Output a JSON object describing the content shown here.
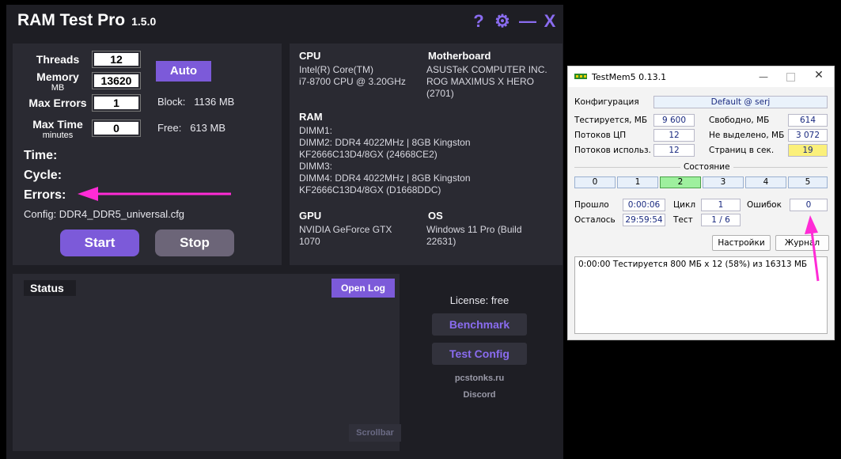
{
  "app": {
    "title": "RAM Test Pro",
    "version": "1.5.0"
  },
  "header": {
    "help_icon": "?",
    "gear_icon": "⚙",
    "minimize_icon": "—",
    "close_icon": "X"
  },
  "settings": {
    "threads_label": "Threads",
    "threads_value": "12",
    "memory_label": "Memory",
    "memory_unit": "MB",
    "memory_value": "13620",
    "max_errors_label": "Max Errors",
    "max_errors_value": "1",
    "max_time_label": "Max Time",
    "max_time_unit": "minutes",
    "max_time_value": "0",
    "auto_label": "Auto",
    "block_label": "Block:",
    "block_value": "1136 MB",
    "free_label": "Free:",
    "free_value": "613 MB"
  },
  "stats": {
    "time_label": "Time:",
    "cycle_label": "Cycle:",
    "errors_label": "Errors:"
  },
  "config": {
    "text": "Config: DDR4_DDR5_universal.cfg"
  },
  "controls": {
    "start_label": "Start",
    "stop_label": "Stop"
  },
  "system": {
    "cpu_label": "CPU",
    "cpu_lines": [
      "Intel(R) Core(TM)",
      "i7-8700 CPU @ 3.20GHz"
    ],
    "mb_label": "Motherboard",
    "mb_lines": [
      "ASUSTeK COMPUTER INC.",
      "ROG MAXIMUS X HERO",
      "(2701)"
    ],
    "ram_label": "RAM",
    "ram_lines": [
      "DIMM1:",
      "DIMM2: DDR4 4022MHz | 8GB Kingston",
      "KF2666C13D4/8GX (24668CE2)",
      "DIMM3:",
      "DIMM4: DDR4 4022MHz | 8GB Kingston",
      "KF2666C13D4/8GX (D1668DDC)"
    ],
    "gpu_label": "GPU",
    "gpu_lines": [
      "NVIDIA GeForce GTX",
      "1070"
    ],
    "os_label": "OS",
    "os_lines": [
      "Windows 11 Pro (Build",
      "22631)"
    ]
  },
  "status": {
    "title": "Status",
    "open_log_label": "Open Log",
    "scrollbar_label": "Scrollbar"
  },
  "side": {
    "license_text": "License: free",
    "benchmark_label": "Benchmark",
    "test_config_label": "Test Config",
    "site_text": "pcstonks.ru",
    "discord_text": "Discord"
  },
  "testmem": {
    "title": "TestMem5  0.13.1",
    "config_label": "Конфигурация",
    "config_value": "Default @ serj",
    "tested_label": "Тестируется, МБ",
    "tested_value": "9 600",
    "free_label": "Свободно, МБ",
    "free_value": "614",
    "threads_label": "Потоков ЦП",
    "threads_value": "12",
    "unalloc_label": "Не выделено, МБ",
    "unalloc_value": "3 072",
    "used_threads_label": "Потоков использ.",
    "used_threads_value": "12",
    "pages_label": "Страниц в сек.",
    "pages_value": "19",
    "state_label": "Состояние",
    "states": [
      "0",
      "1",
      "2",
      "3",
      "4",
      "5"
    ],
    "elapsed_label": "Прошло",
    "elapsed_value": "0:00:06",
    "remaining_label": "Осталось",
    "remaining_value": "29:59:54",
    "cycle_label": "Цикл",
    "cycle_value": "1",
    "test_label": "Тест",
    "test_value": "1 / 6",
    "errors_label": "Ошибок",
    "errors_value": "0",
    "settings_btn": "Настройки",
    "journal_btn": "Журнал",
    "log_line": "0:00:00  Тестируется 800 МБ x 12 (58%) из 16313 МБ",
    "pages_highlight_color": "#fbf07a",
    "active_state_color": "#9ef09e"
  },
  "colors": {
    "accent": "#7c5ad9",
    "arrow": "#ff2bd6",
    "panel": "#2a2a32",
    "window": "#1e1e24"
  }
}
